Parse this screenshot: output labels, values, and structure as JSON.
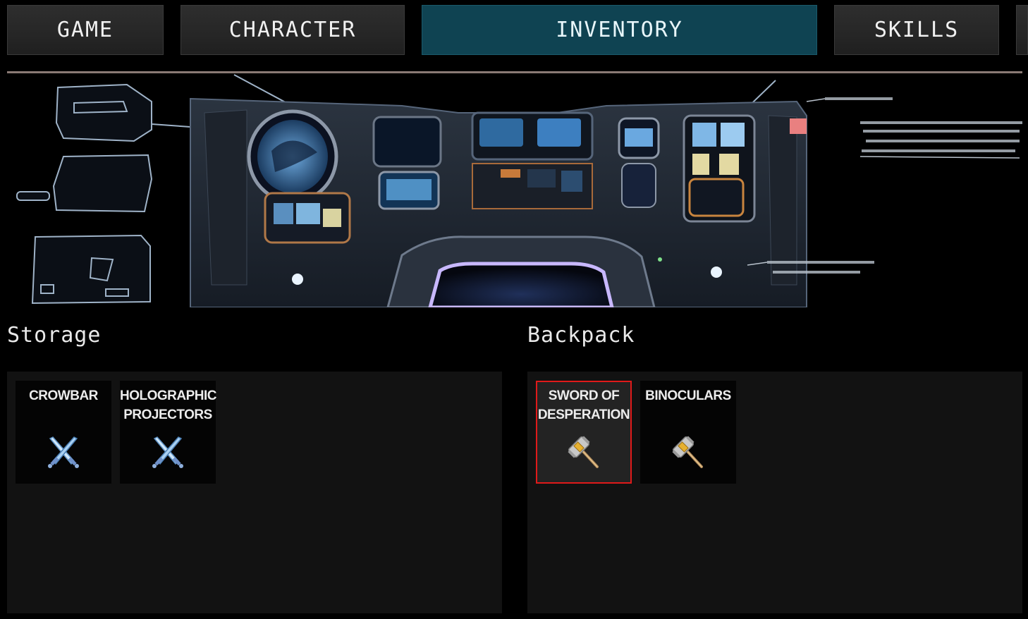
{
  "tabs": [
    {
      "label": "GAME",
      "active": false
    },
    {
      "label": "CHARACTER",
      "active": false
    },
    {
      "label": "INVENTORY",
      "active": true
    },
    {
      "label": "SKILLS",
      "active": false
    }
  ],
  "banner": {
    "description_lines": [
      "",
      "",
      "",
      ""
    ]
  },
  "storage": {
    "title": "Storage",
    "items": [
      {
        "name": "CROWBAR",
        "icon": "crossed-swords-icon"
      },
      {
        "name": "HOLOGRAPHIC PROJECTORS",
        "icon": "crossed-swords-icon"
      }
    ]
  },
  "backpack": {
    "title": "Backpack",
    "items": [
      {
        "name": "SWORD OF DESPERATION",
        "icon": "hammer-icon",
        "selected": true
      },
      {
        "name": "BINOCULARS",
        "icon": "hammer-icon",
        "selected": false
      }
    ]
  },
  "colors": {
    "active_tab": "#0f4352",
    "tab": "#262626",
    "panel": "#121212",
    "selected_border": "#e01a1a"
  }
}
